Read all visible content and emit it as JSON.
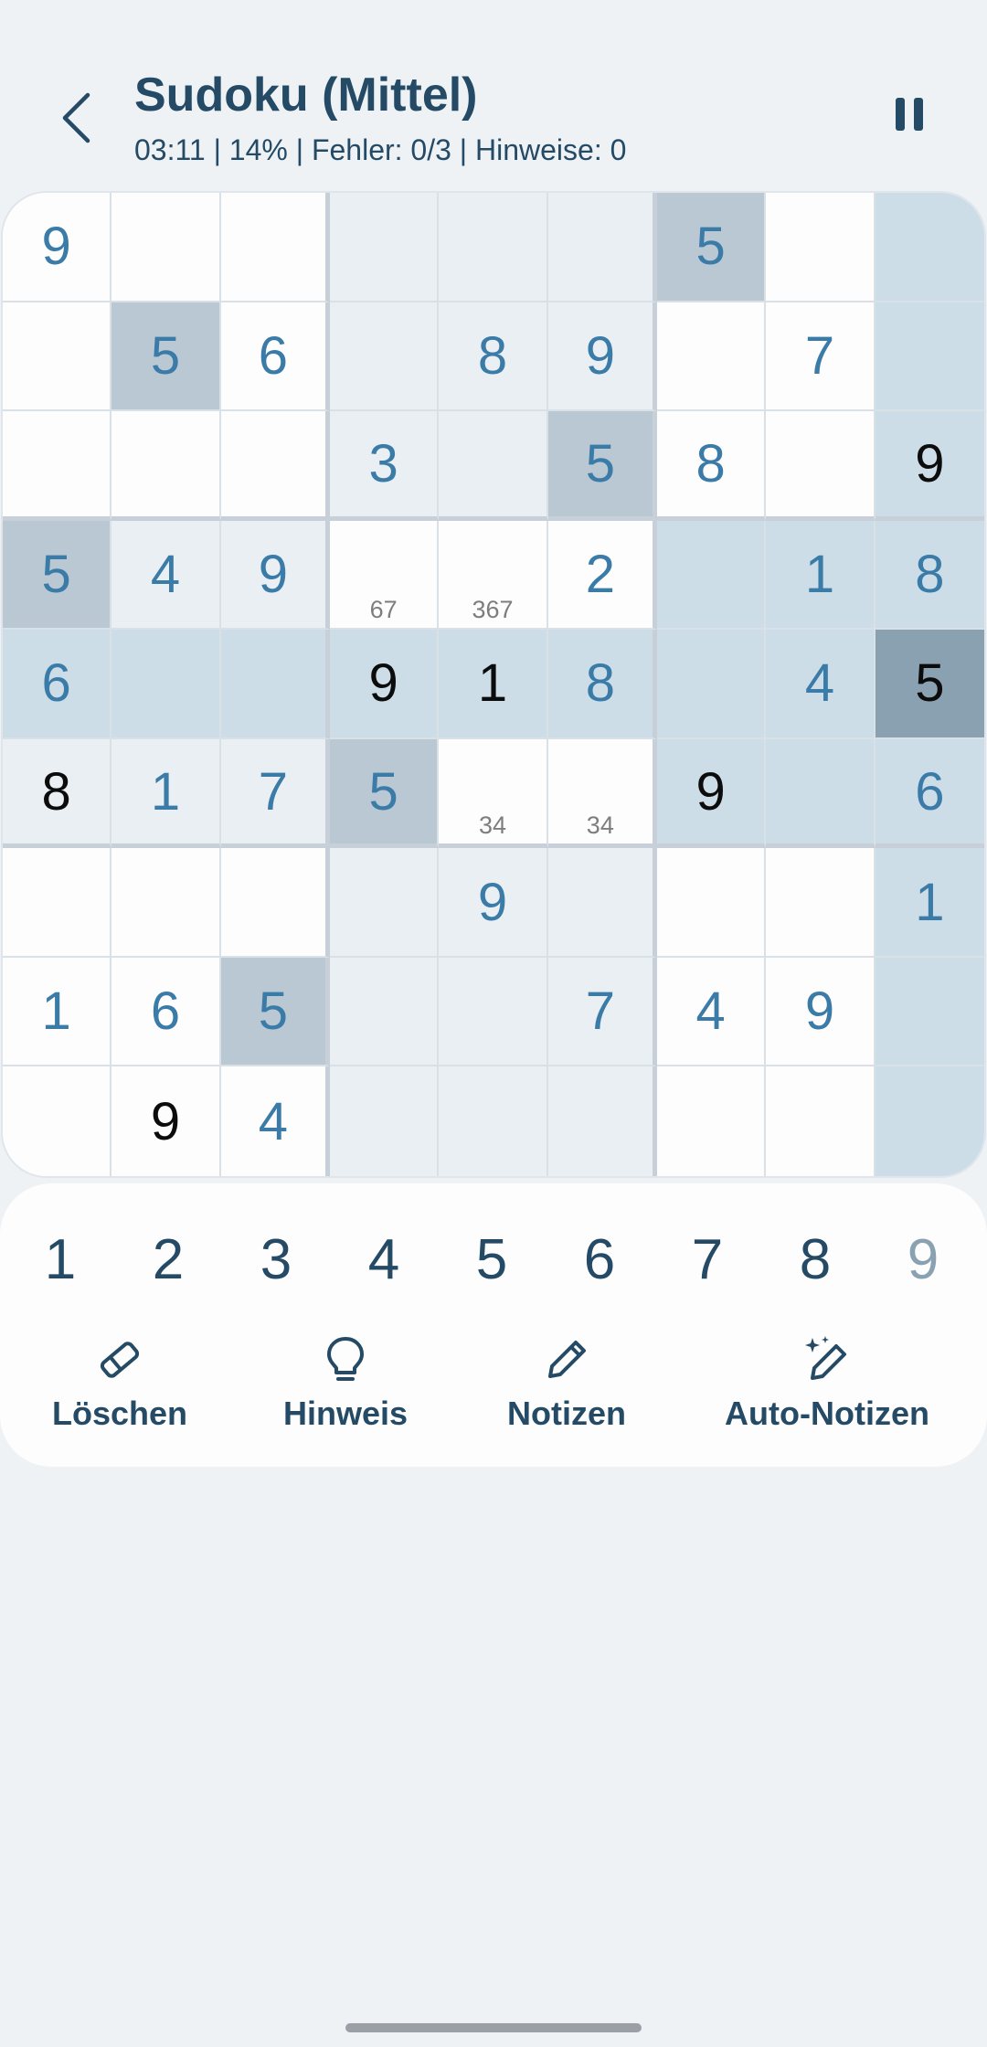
{
  "header": {
    "title": "Sudoku (Mittel)",
    "status": "03:11 | 14% | Fehler: 0/3 | Hinweise: 0",
    "back_icon": "chevron-left-icon",
    "pause_icon": "pause-icon"
  },
  "board": {
    "cells": [
      {
        "value": "9",
        "kind": "given",
        "bg": "white"
      },
      {
        "value": "",
        "kind": "",
        "bg": "white"
      },
      {
        "value": "",
        "kind": "",
        "bg": "white"
      },
      {
        "value": "",
        "kind": "",
        "bg": "light"
      },
      {
        "value": "",
        "kind": "",
        "bg": "light"
      },
      {
        "value": "",
        "kind": "",
        "bg": "light"
      },
      {
        "value": "5",
        "kind": "given",
        "bg": "gray"
      },
      {
        "value": "",
        "kind": "",
        "bg": "white"
      },
      {
        "value": "",
        "kind": "",
        "bg": "blue"
      },
      {
        "value": "",
        "kind": "",
        "bg": "white"
      },
      {
        "value": "5",
        "kind": "given",
        "bg": "gray"
      },
      {
        "value": "6",
        "kind": "given",
        "bg": "white"
      },
      {
        "value": "",
        "kind": "",
        "bg": "light"
      },
      {
        "value": "8",
        "kind": "given",
        "bg": "light"
      },
      {
        "value": "9",
        "kind": "given",
        "bg": "light"
      },
      {
        "value": "",
        "kind": "",
        "bg": "white"
      },
      {
        "value": "7",
        "kind": "given",
        "bg": "white"
      },
      {
        "value": "",
        "kind": "",
        "bg": "blue"
      },
      {
        "value": "",
        "kind": "",
        "bg": "white"
      },
      {
        "value": "",
        "kind": "",
        "bg": "white"
      },
      {
        "value": "",
        "kind": "",
        "bg": "white"
      },
      {
        "value": "3",
        "kind": "given",
        "bg": "light"
      },
      {
        "value": "",
        "kind": "",
        "bg": "light"
      },
      {
        "value": "5",
        "kind": "given",
        "bg": "gray"
      },
      {
        "value": "8",
        "kind": "given",
        "bg": "white"
      },
      {
        "value": "",
        "kind": "",
        "bg": "white"
      },
      {
        "value": "9",
        "kind": "user",
        "bg": "blue"
      },
      {
        "value": "5",
        "kind": "given",
        "bg": "gray"
      },
      {
        "value": "4",
        "kind": "given",
        "bg": "light"
      },
      {
        "value": "9",
        "kind": "given",
        "bg": "light"
      },
      {
        "value": "",
        "kind": "",
        "bg": "white",
        "notes": "67"
      },
      {
        "value": "",
        "kind": "",
        "bg": "white",
        "notes": "367"
      },
      {
        "value": "2",
        "kind": "given",
        "bg": "white"
      },
      {
        "value": "",
        "kind": "",
        "bg": "blue"
      },
      {
        "value": "1",
        "kind": "given",
        "bg": "blue"
      },
      {
        "value": "8",
        "kind": "given",
        "bg": "blue"
      },
      {
        "value": "6",
        "kind": "given",
        "bg": "blue"
      },
      {
        "value": "",
        "kind": "",
        "bg": "blue"
      },
      {
        "value": "",
        "kind": "",
        "bg": "blue"
      },
      {
        "value": "9",
        "kind": "user",
        "bg": "blue"
      },
      {
        "value": "1",
        "kind": "user",
        "bg": "blue"
      },
      {
        "value": "8",
        "kind": "given",
        "bg": "blue"
      },
      {
        "value": "",
        "kind": "",
        "bg": "blue"
      },
      {
        "value": "4",
        "kind": "given",
        "bg": "blue"
      },
      {
        "value": "5",
        "kind": "user",
        "bg": "dark"
      },
      {
        "value": "8",
        "kind": "user",
        "bg": "light"
      },
      {
        "value": "1",
        "kind": "given",
        "bg": "light"
      },
      {
        "value": "7",
        "kind": "given",
        "bg": "light"
      },
      {
        "value": "5",
        "kind": "given",
        "bg": "gray"
      },
      {
        "value": "",
        "kind": "",
        "bg": "white",
        "notes": "34"
      },
      {
        "value": "",
        "kind": "",
        "bg": "white",
        "notes": "34"
      },
      {
        "value": "9",
        "kind": "user",
        "bg": "blue"
      },
      {
        "value": "",
        "kind": "",
        "bg": "blue"
      },
      {
        "value": "6",
        "kind": "given",
        "bg": "blue"
      },
      {
        "value": "",
        "kind": "",
        "bg": "white"
      },
      {
        "value": "",
        "kind": "",
        "bg": "white"
      },
      {
        "value": "",
        "kind": "",
        "bg": "white"
      },
      {
        "value": "",
        "kind": "",
        "bg": "light"
      },
      {
        "value": "9",
        "kind": "given",
        "bg": "light"
      },
      {
        "value": "",
        "kind": "",
        "bg": "light"
      },
      {
        "value": "",
        "kind": "",
        "bg": "white"
      },
      {
        "value": "",
        "kind": "",
        "bg": "white"
      },
      {
        "value": "1",
        "kind": "given",
        "bg": "blue"
      },
      {
        "value": "1",
        "kind": "given",
        "bg": "white"
      },
      {
        "value": "6",
        "kind": "given",
        "bg": "white"
      },
      {
        "value": "5",
        "kind": "given",
        "bg": "gray"
      },
      {
        "value": "",
        "kind": "",
        "bg": "light"
      },
      {
        "value": "",
        "kind": "",
        "bg": "light"
      },
      {
        "value": "7",
        "kind": "given",
        "bg": "light"
      },
      {
        "value": "4",
        "kind": "given",
        "bg": "white"
      },
      {
        "value": "9",
        "kind": "given",
        "bg": "white"
      },
      {
        "value": "",
        "kind": "",
        "bg": "blue"
      },
      {
        "value": "",
        "kind": "",
        "bg": "white"
      },
      {
        "value": "9",
        "kind": "user",
        "bg": "white"
      },
      {
        "value": "4",
        "kind": "given",
        "bg": "white"
      },
      {
        "value": "",
        "kind": "",
        "bg": "light"
      },
      {
        "value": "",
        "kind": "",
        "bg": "light"
      },
      {
        "value": "",
        "kind": "",
        "bg": "light"
      },
      {
        "value": "",
        "kind": "",
        "bg": "white"
      },
      {
        "value": "",
        "kind": "",
        "bg": "white"
      },
      {
        "value": "",
        "kind": "",
        "bg": "blue"
      }
    ]
  },
  "numpad": {
    "numbers": [
      "1",
      "2",
      "3",
      "4",
      "5",
      "6",
      "7",
      "8",
      "9"
    ],
    "completed": [
      "9"
    ]
  },
  "actions": {
    "erase": {
      "label": "Löschen",
      "icon": "eraser-icon"
    },
    "hint": {
      "label": "Hinweis",
      "icon": "lightbulb-icon"
    },
    "notes": {
      "label": "Notizen",
      "icon": "pencil-icon"
    },
    "auto_notes": {
      "label": "Auto-Notizen",
      "icon": "magic-pencil-icon"
    }
  },
  "colors": {
    "background": "#eef2f5",
    "text_dark": "#244a66",
    "given_digit": "#3b7ba8",
    "user_digit": "#0c0c0c",
    "highlight": "#cddde8",
    "selected": "#8aa1b2"
  }
}
